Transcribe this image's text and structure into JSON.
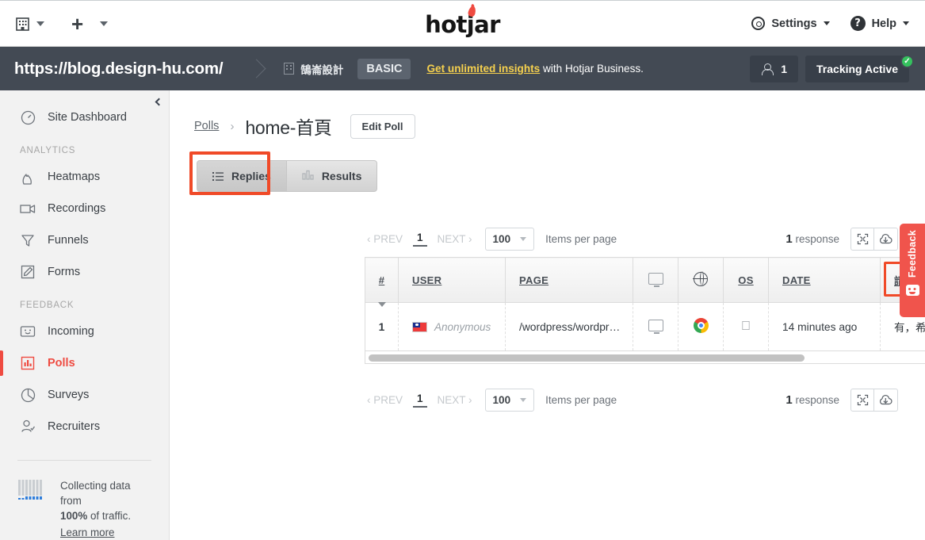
{
  "browser_toolbar": {
    "org_switcher_icon": "building-icon",
    "org_switcher_caret": "caret-down-icon",
    "add_icon": "plus-icon",
    "add_caret": "caret-down-icon"
  },
  "header": {
    "logo_text": "hotjar",
    "settings_label": "Settings",
    "help_label": "Help",
    "settings_icon": "gear-icon",
    "help_icon": "question-mark-icon"
  },
  "sitebar": {
    "url": "https://blog.design-hu.com/",
    "org_name": "鵠崙設計",
    "plan_badge": "BASIC",
    "promo_link": "Get unlimited insights",
    "promo_rest": " with Hotjar Business.",
    "users_count": "1",
    "tracking_label": "Tracking Active",
    "tracking_ok_icon": "check-circle-icon",
    "accent_yellow": "#f5d04e",
    "bg": "#434a54"
  },
  "sidebar": {
    "collapse_icon": "chevron-left-icon",
    "top_item": {
      "label": "Site Dashboard",
      "icon": "gauge-icon"
    },
    "sections": [
      {
        "title": "ANALYTICS",
        "items": [
          {
            "label": "Heatmaps",
            "icon": "flame-icon"
          },
          {
            "label": "Recordings",
            "icon": "video-camera-icon"
          },
          {
            "label": "Funnels",
            "icon": "funnel-icon"
          },
          {
            "label": "Forms",
            "icon": "pencil-square-icon"
          }
        ]
      },
      {
        "title": "FEEDBACK",
        "items": [
          {
            "label": "Incoming",
            "icon": "smiley-box-icon"
          },
          {
            "label": "Polls",
            "icon": "bar-chart-icon",
            "active": true
          },
          {
            "label": "Surveys",
            "icon": "pie-chart-icon"
          },
          {
            "label": "Recruiters",
            "icon": "user-check-icon"
          }
        ]
      }
    ],
    "footer": {
      "icon": "signal-bars-icon",
      "text_before": "Collecting data from",
      "percent": "100%",
      "text_after": " of traffic.",
      "learn_more": "Learn more"
    },
    "active_color": "#ef4b41"
  },
  "main": {
    "breadcrumb": {
      "parent": "Polls",
      "separator": "›",
      "current": "home-首頁"
    },
    "edit_button": "Edit Poll",
    "tabs": [
      {
        "label": "Replies",
        "icon": "list-icon",
        "selected": true
      },
      {
        "label": "Results",
        "icon": "bar-chart-icon",
        "selected": false
      }
    ],
    "highlight_color": "#f04a28",
    "pagination": {
      "prev": "‹ PREV",
      "page": "1",
      "next": "NEXT ›",
      "items_per_page_value": "100",
      "items_per_page_label": "Items per page",
      "response_count": "1",
      "response_word": "response",
      "expand_icon": "expand-icon",
      "download_icon": "download-icon"
    },
    "table": {
      "columns": [
        {
          "key": "num",
          "label": "#",
          "sorted": true
        },
        {
          "key": "user",
          "label": "USER"
        },
        {
          "key": "page",
          "label": "PAGE"
        },
        {
          "key": "device",
          "label": "",
          "icon": "monitor-icon"
        },
        {
          "key": "browser",
          "label": "",
          "icon": "globe-icon"
        },
        {
          "key": "os",
          "label": "OS"
        },
        {
          "key": "date",
          "label": "DATE"
        },
        {
          "key": "question",
          "label": "請問鵠學苑 WordPress 教學對您有幫助嗎？"
        }
      ],
      "rows": [
        {
          "num": "1",
          "flag": "taiwan-flag-icon",
          "user": "Anonymous",
          "page": "/wordpress/wordpr…",
          "device": "monitor-icon",
          "browser": "chrome-icon",
          "os": "apple-icon",
          "date": "14 minutes ago",
          "question": "有，希望以後能有更多的教學"
        }
      ]
    },
    "scrollbar": "horizontal-scrollbar"
  },
  "feedback_tab": {
    "label": "Feedback",
    "icon": "smiley-icon",
    "color": "#f0544c"
  }
}
